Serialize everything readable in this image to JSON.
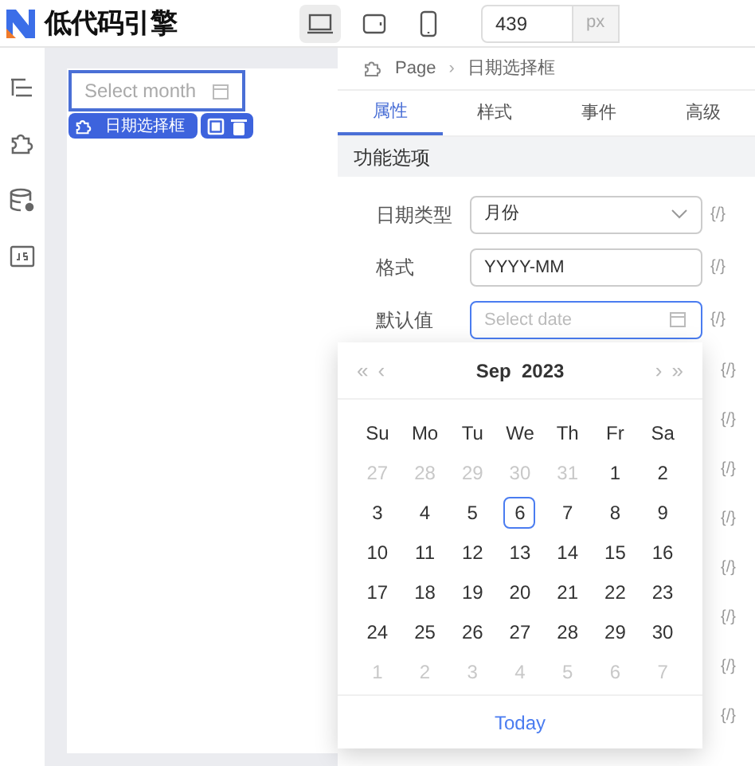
{
  "logo": {
    "text": "低代码引擎"
  },
  "devices": [
    {
      "kind": "desktop",
      "selected": true
    },
    {
      "kind": "tablet",
      "selected": false
    },
    {
      "kind": "phone",
      "selected": false
    }
  ],
  "width_field": {
    "value": "439",
    "unit": "px"
  },
  "canvas": {
    "component": {
      "placeholder": "Select month"
    },
    "selection": {
      "label": "日期选择框"
    }
  },
  "breadcrumb": [
    "Page",
    "日期选择框"
  ],
  "breadcrumb_separator": "›",
  "tabs": [
    {
      "label": "属性",
      "selected": true
    },
    {
      "label": "样式",
      "selected": false
    },
    {
      "label": "事件",
      "selected": false
    },
    {
      "label": "高级",
      "selected": false
    }
  ],
  "section": "功能选项",
  "fields": [
    {
      "label": "日期类型",
      "kind": "select",
      "value": "月份",
      "binding": "{/}"
    },
    {
      "label": "格式",
      "kind": "text",
      "value": "YYYY-MM",
      "binding": "{/}"
    },
    {
      "label": "默认值",
      "kind": "date",
      "placeholder": "Select date",
      "focused": true,
      "binding": "{/}"
    }
  ],
  "more_bindings": [
    "{/}",
    "{/}",
    "{/}",
    "{/}",
    "{/}",
    "{/}",
    "{/}",
    "{/}"
  ],
  "calendar": {
    "nav": [
      "«",
      "‹",
      "›",
      "»"
    ],
    "month": "Sep",
    "year": "2023",
    "weekdays": [
      "Su",
      "Mo",
      "Tu",
      "We",
      "Th",
      "Fr",
      "Sa"
    ],
    "weeks": [
      [
        {
          "day": "27",
          "in_month": false,
          "selected": false
        },
        {
          "day": "28",
          "in_month": false,
          "selected": false
        },
        {
          "day": "29",
          "in_month": false,
          "selected": false
        },
        {
          "day": "30",
          "in_month": false,
          "selected": false
        },
        {
          "day": "31",
          "in_month": false,
          "selected": false
        },
        {
          "day": "1",
          "in_month": true,
          "selected": false
        },
        {
          "day": "2",
          "in_month": true,
          "selected": false
        }
      ],
      [
        {
          "day": "3",
          "in_month": true,
          "selected": false
        },
        {
          "day": "4",
          "in_month": true,
          "selected": false
        },
        {
          "day": "5",
          "in_month": true,
          "selected": false
        },
        {
          "day": "6",
          "in_month": true,
          "selected": true
        },
        {
          "day": "7",
          "in_month": true,
          "selected": false
        },
        {
          "day": "8",
          "in_month": true,
          "selected": false
        },
        {
          "day": "9",
          "in_month": true,
          "selected": false
        }
      ],
      [
        {
          "day": "10",
          "in_month": true,
          "selected": false
        },
        {
          "day": "11",
          "in_month": true,
          "selected": false
        },
        {
          "day": "12",
          "in_month": true,
          "selected": false
        },
        {
          "day": "13",
          "in_month": true,
          "selected": false
        },
        {
          "day": "14",
          "in_month": true,
          "selected": false
        },
        {
          "day": "15",
          "in_month": true,
          "selected": false
        },
        {
          "day": "16",
          "in_month": true,
          "selected": false
        }
      ],
      [
        {
          "day": "17",
          "in_month": true,
          "selected": false
        },
        {
          "day": "18",
          "in_month": true,
          "selected": false
        },
        {
          "day": "19",
          "in_month": true,
          "selected": false
        },
        {
          "day": "20",
          "in_month": true,
          "selected": false
        },
        {
          "day": "21",
          "in_month": true,
          "selected": false
        },
        {
          "day": "22",
          "in_month": true,
          "selected": false
        },
        {
          "day": "23",
          "in_month": true,
          "selected": false
        }
      ],
      [
        {
          "day": "24",
          "in_month": true,
          "selected": false
        },
        {
          "day": "25",
          "in_month": true,
          "selected": false
        },
        {
          "day": "26",
          "in_month": true,
          "selected": false
        },
        {
          "day": "27",
          "in_month": true,
          "selected": false
        },
        {
          "day": "28",
          "in_month": true,
          "selected": false
        },
        {
          "day": "29",
          "in_month": true,
          "selected": false
        },
        {
          "day": "30",
          "in_month": true,
          "selected": false
        }
      ],
      [
        {
          "day": "1",
          "in_month": false,
          "selected": false
        },
        {
          "day": "2",
          "in_month": false,
          "selected": false
        },
        {
          "day": "3",
          "in_month": false,
          "selected": false
        },
        {
          "day": "4",
          "in_month": false,
          "selected": false
        },
        {
          "day": "5",
          "in_month": false,
          "selected": false
        },
        {
          "day": "6",
          "in_month": false,
          "selected": false
        },
        {
          "day": "7",
          "in_month": false,
          "selected": false
        }
      ]
    ],
    "today_button": "Today"
  }
}
